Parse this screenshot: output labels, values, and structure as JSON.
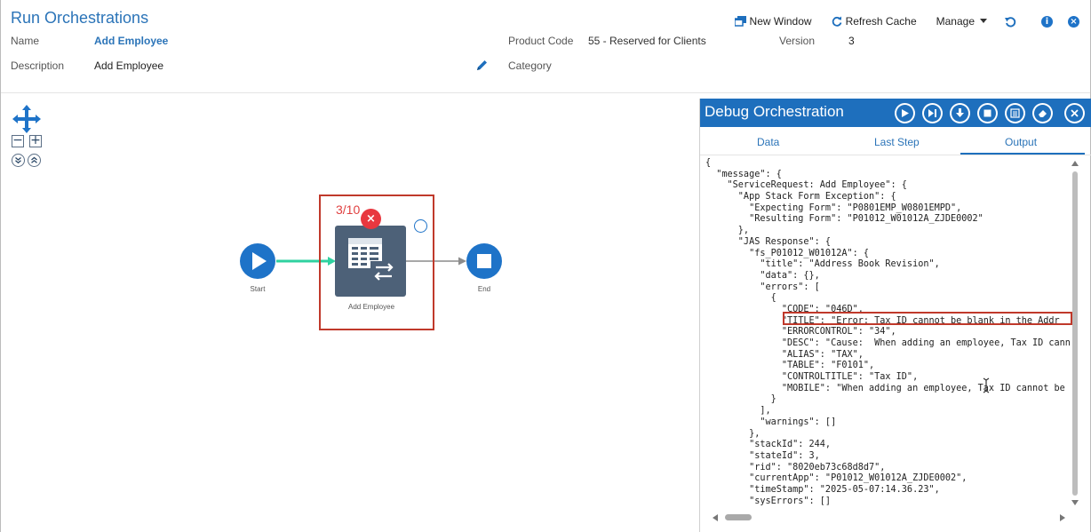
{
  "header": {
    "title": "Run Orchestrations",
    "name_label": "Name",
    "name_value": "Add Employee",
    "description_label": "Description",
    "description_value": "Add Employee",
    "product_code_label": "Product Code",
    "product_code_value": "55 - Reserved for Clients",
    "version_label": "Version",
    "version_value": "3",
    "category_label": "Category"
  },
  "toolbar": {
    "new_window": "New Window",
    "refresh_cache": "Refresh Cache",
    "manage": "Manage",
    "new_window_icon": "new-window-icon",
    "refresh_icon": "refresh-icon",
    "undo_icon": "reload-icon",
    "info_icon": "info-icon",
    "close_icon": "close-icon"
  },
  "flow": {
    "start_label": "Start",
    "step_label": "Add Employee",
    "end_label": "End",
    "step_counter": "3/10"
  },
  "debug": {
    "title": "Debug Orchestration",
    "tabs": [
      "Data",
      "Last Step",
      "Output"
    ],
    "active_tab": "Output",
    "buttons": [
      "play-icon",
      "step-over-icon",
      "step-into-icon",
      "stop-icon",
      "list-icon",
      "eraser-icon",
      "close-icon"
    ],
    "output_lines": [
      "{",
      "  \"message\": {",
      "    \"ServiceRequest: Add Employee\": {",
      "      \"App Stack Form Exception\": {",
      "        \"Expecting Form\": \"P0801EMP_W0801EMPD\",",
      "        \"Resulting Form\": \"P01012_W01012A_ZJDE0002\"",
      "      },",
      "      \"JAS Response\": {",
      "        \"fs_P01012_W01012A\": {",
      "          \"title\": \"Address Book Revision\",",
      "          \"data\": {},",
      "          \"errors\": [",
      "            {",
      "              \"CODE\": \"046D\",",
      "              \"TITLE\": \"Error: Tax ID cannot be blank in the Addr",
      "              \"ERRORCONTROL\": \"34\",",
      "              \"DESC\": \"Cause:  When adding an employee, Tax ID cann",
      "              \"ALIAS\": \"TAX\",",
      "              \"TABLE\": \"F0101\",",
      "              \"CONTROLTITLE\": \"Tax ID\",",
      "              \"MOBILE\": \"When adding an employee, Tax ID cannot be",
      "            }",
      "          ],",
      "          \"warnings\": []",
      "        },",
      "        \"stackId\": 244,",
      "        \"stateId\": 3,",
      "        \"rid\": \"8020eb73c68d8d7\",",
      "        \"currentApp\": \"P01012_W01012A_ZJDE0002\",",
      "        \"timeStamp\": \"2025-05-07:14.36.23\",",
      "        \"sysErrors\": []",
      "      }"
    ]
  },
  "colors": {
    "accent": "#1e6fbd",
    "error": "#c0392b",
    "connector": "#2fd1a0",
    "step": "#4d6178"
  }
}
